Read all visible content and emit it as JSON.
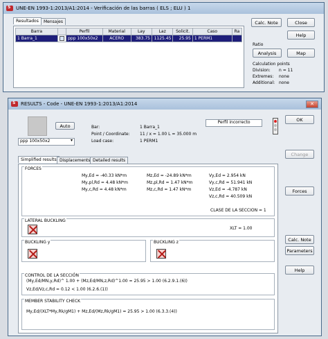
{
  "win1": {
    "title": "UNE-EN 1993-1:2013/A1:2014  -  Verificación de las barras ( ELS ; ELU ) 1",
    "tabs": [
      "Resultados",
      "Mensajes"
    ],
    "columns": [
      "Barra",
      "",
      "Perfil",
      "Material",
      "Lay",
      "Laz",
      "Solicit.",
      "Caso",
      "Ra"
    ],
    "row": {
      "barra": "1  Barra_1",
      "perfil": "ppp 100x50x2",
      "material": "ACERO",
      "lay": "383.75",
      "laz": "1125.45",
      "solicit": "25.95",
      "caso": "1 PERM1"
    },
    "buttons": {
      "calc_note": "Calc. Note",
      "close": "Close",
      "help": "Help",
      "analysis": "Analysis",
      "map": "Map"
    },
    "ratio_label": "Ratio",
    "calc_points": {
      "title": "Calculation points",
      "division_label": "Division:",
      "division": "n = 11",
      "extremes_label": "Extremes:",
      "extremes": "none",
      "additional_label": "Additional:",
      "additional": "none"
    }
  },
  "win2": {
    "title": "RESULTS - Code - UNE-EN 1993-1:2013/A1:2014",
    "auto_label": "Auto",
    "section": "ppp 100x50x2",
    "bar_label": "Bar:",
    "bar_value": "1  Barra_1",
    "point_label": "Point / Coordinate:",
    "point_value": "11 / x = 1.00 L = 35.000 m",
    "load_label": "Load case:",
    "load_value": "1 PERM1",
    "status": "Perfil incorrecto",
    "tabs": [
      "Simplified results",
      "Displacements",
      "Detailed results"
    ],
    "buttons": {
      "ok": "OK",
      "change": "Change",
      "forces": "Forces",
      "calc_note": "Calc. Note",
      "parameters": "Parameters",
      "help": "Help"
    },
    "forces": {
      "title": "FORCES",
      "c1": [
        "My,Ed = -40.33 kN*m",
        "My,pl,Rd = 4.48 kN*m",
        "My,c,Rd = 4.48 kN*m"
      ],
      "c2": [
        "Mz,Ed = -24.89 kN*m",
        "Mz,pl,Rd = 1.47 kN*m",
        "Mz,c,Rd = 1.47 kN*m"
      ],
      "c3": [
        "Vy,Ed = 2.954 kN",
        "Vy,c,Rd = 51.941 kN",
        "Vz,Ed = -4.787 kN",
        "Vz,c,Rd = 40.509 kN"
      ],
      "clase": "CLASE DE LA SECCION = 1"
    },
    "lateral": {
      "title": "LATERAL BUCKLING",
      "xlt": "XLT = 1.00"
    },
    "buckling_y": "BUCKLING y",
    "buckling_z": "BUCKLING z",
    "control": {
      "title": "CONTROL DE LA SECCIÓN",
      "l1": "(My,Ed/MN,y,Rd)^ 1.00 + (Mz,Ed/MN,z,Rd)^1.00 = 25.95 > 1.00   (6.2.9.1.(6))",
      "l2": "Vz,Ed/Vz,c,Rd = 0.12 < 1.00   (6.2.6.(1))"
    },
    "member": {
      "title": "MEMBER STABILITY CHECK",
      "l1": "My,Ed/(XLT*My,Rk/gM1) + Mz,Ed/(Mz,Rk/gM1) = 25.95 > 1.00   (6.3.3.(4))"
    }
  }
}
